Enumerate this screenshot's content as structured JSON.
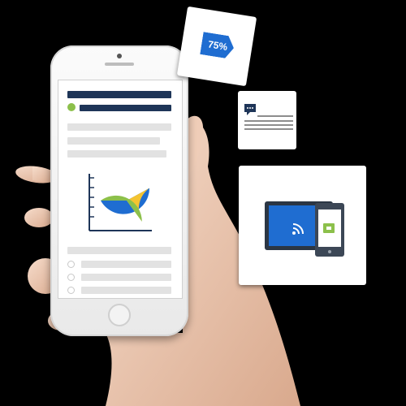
{
  "percent_badge": {
    "label": "75%"
  },
  "colors": {
    "navy": "#1e3558",
    "blue": "#1f6dd1",
    "green": "#8cc04b",
    "yellow": "#f4c431",
    "gray": "#e2e2e2",
    "background": "#000000"
  },
  "icons": {
    "chat": "chat-bubble-icon",
    "wifi": "wifi-icon",
    "cart": "shopping-cart-icon"
  },
  "chart_data": {
    "type": "pie",
    "categories": [
      "blue",
      "yellow",
      "green"
    ],
    "values": [
      42,
      23,
      35
    ],
    "colors": [
      "#1f6dd1",
      "#f4c431",
      "#8cc04b"
    ]
  }
}
